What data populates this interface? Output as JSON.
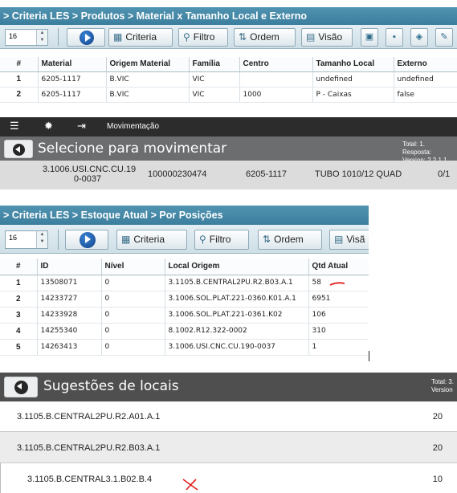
{
  "panel1": {
    "breadcrumb": "> Criteria LES > Produtos > Material x Tamanho Local e Externo",
    "page_size": "16",
    "buttons": {
      "criteria": "Criteria",
      "filtro": "Filtro",
      "ordem": "Ordem",
      "visao": "Visão"
    },
    "columns": [
      "#",
      "Material",
      "Origem Material",
      "Família",
      "Centro",
      "Tamanho Local",
      "Externo"
    ],
    "rows": [
      [
        "1",
        "6205-1117",
        "B.VIC",
        "VIC",
        "",
        "undefined",
        "undefined"
      ],
      [
        "2",
        "6205-1117",
        "B.VIC",
        "VIC",
        "1000",
        "P - Caixas",
        "false"
      ]
    ]
  },
  "movimentacao": {
    "app_title": "Movimentação",
    "heading": "Selecione para movimentar",
    "meta_line1": "Total: 1. Resposta:",
    "meta_line2": "Version: 2.2.1.1",
    "row": {
      "location_line1": "3.1006.USI.CNC.CU.19",
      "location_line2": "0-0037",
      "code": "100000230474",
      "material": "6205-1117",
      "description": "TUBO 1010/12 QUAD",
      "count": "0/1"
    }
  },
  "panel2": {
    "breadcrumb": "> Criteria LES > Estoque Atual > Por Posições",
    "page_size": "16",
    "buttons": {
      "criteria": "Criteria",
      "filtro": "Filtro",
      "ordem": "Ordem",
      "visao": "Visã"
    },
    "columns": [
      "#",
      "ID",
      "Nível",
      "Local Origem",
      "Qtd Atual"
    ],
    "rows": [
      [
        "1",
        "13508071",
        "0",
        "3.1105.B.CENTRAL2PU.R2.B03.A.1",
        "58"
      ],
      [
        "2",
        "14233727",
        "0",
        "3.1006.SOL.PLAT.221-0360.K01.A.1",
        "6951"
      ],
      [
        "3",
        "14233928",
        "0",
        "3.1006.SOL.PLAT.221-0361.K02",
        "106"
      ],
      [
        "4",
        "14255340",
        "0",
        "8.1002.R12.322-0002",
        "310"
      ],
      [
        "5",
        "14263413",
        "0",
        "3.1006.USI.CNC.CU.190-0037",
        "1"
      ]
    ]
  },
  "sugestoes": {
    "heading": "Sugestões de locais",
    "meta_line1": "Total: 3.",
    "meta_line2": "Version",
    "rows": [
      {
        "location": "3.1105.B.CENTRAL2PU.R2.A01.A.1",
        "qty": "20"
      },
      {
        "location": "3.1105.B.CENTRAL2PU.R2.B03.A.1",
        "qty": "20"
      },
      {
        "location": "3.1105.B.CENTRAL3.1.B02.B.4",
        "qty": "10"
      }
    ]
  },
  "colors": {
    "criteria_header": "#4f93b1",
    "annotation_red": "#e02020",
    "dark_bar": "#2c2c2c",
    "gray_bar": "#6b6d6f"
  }
}
